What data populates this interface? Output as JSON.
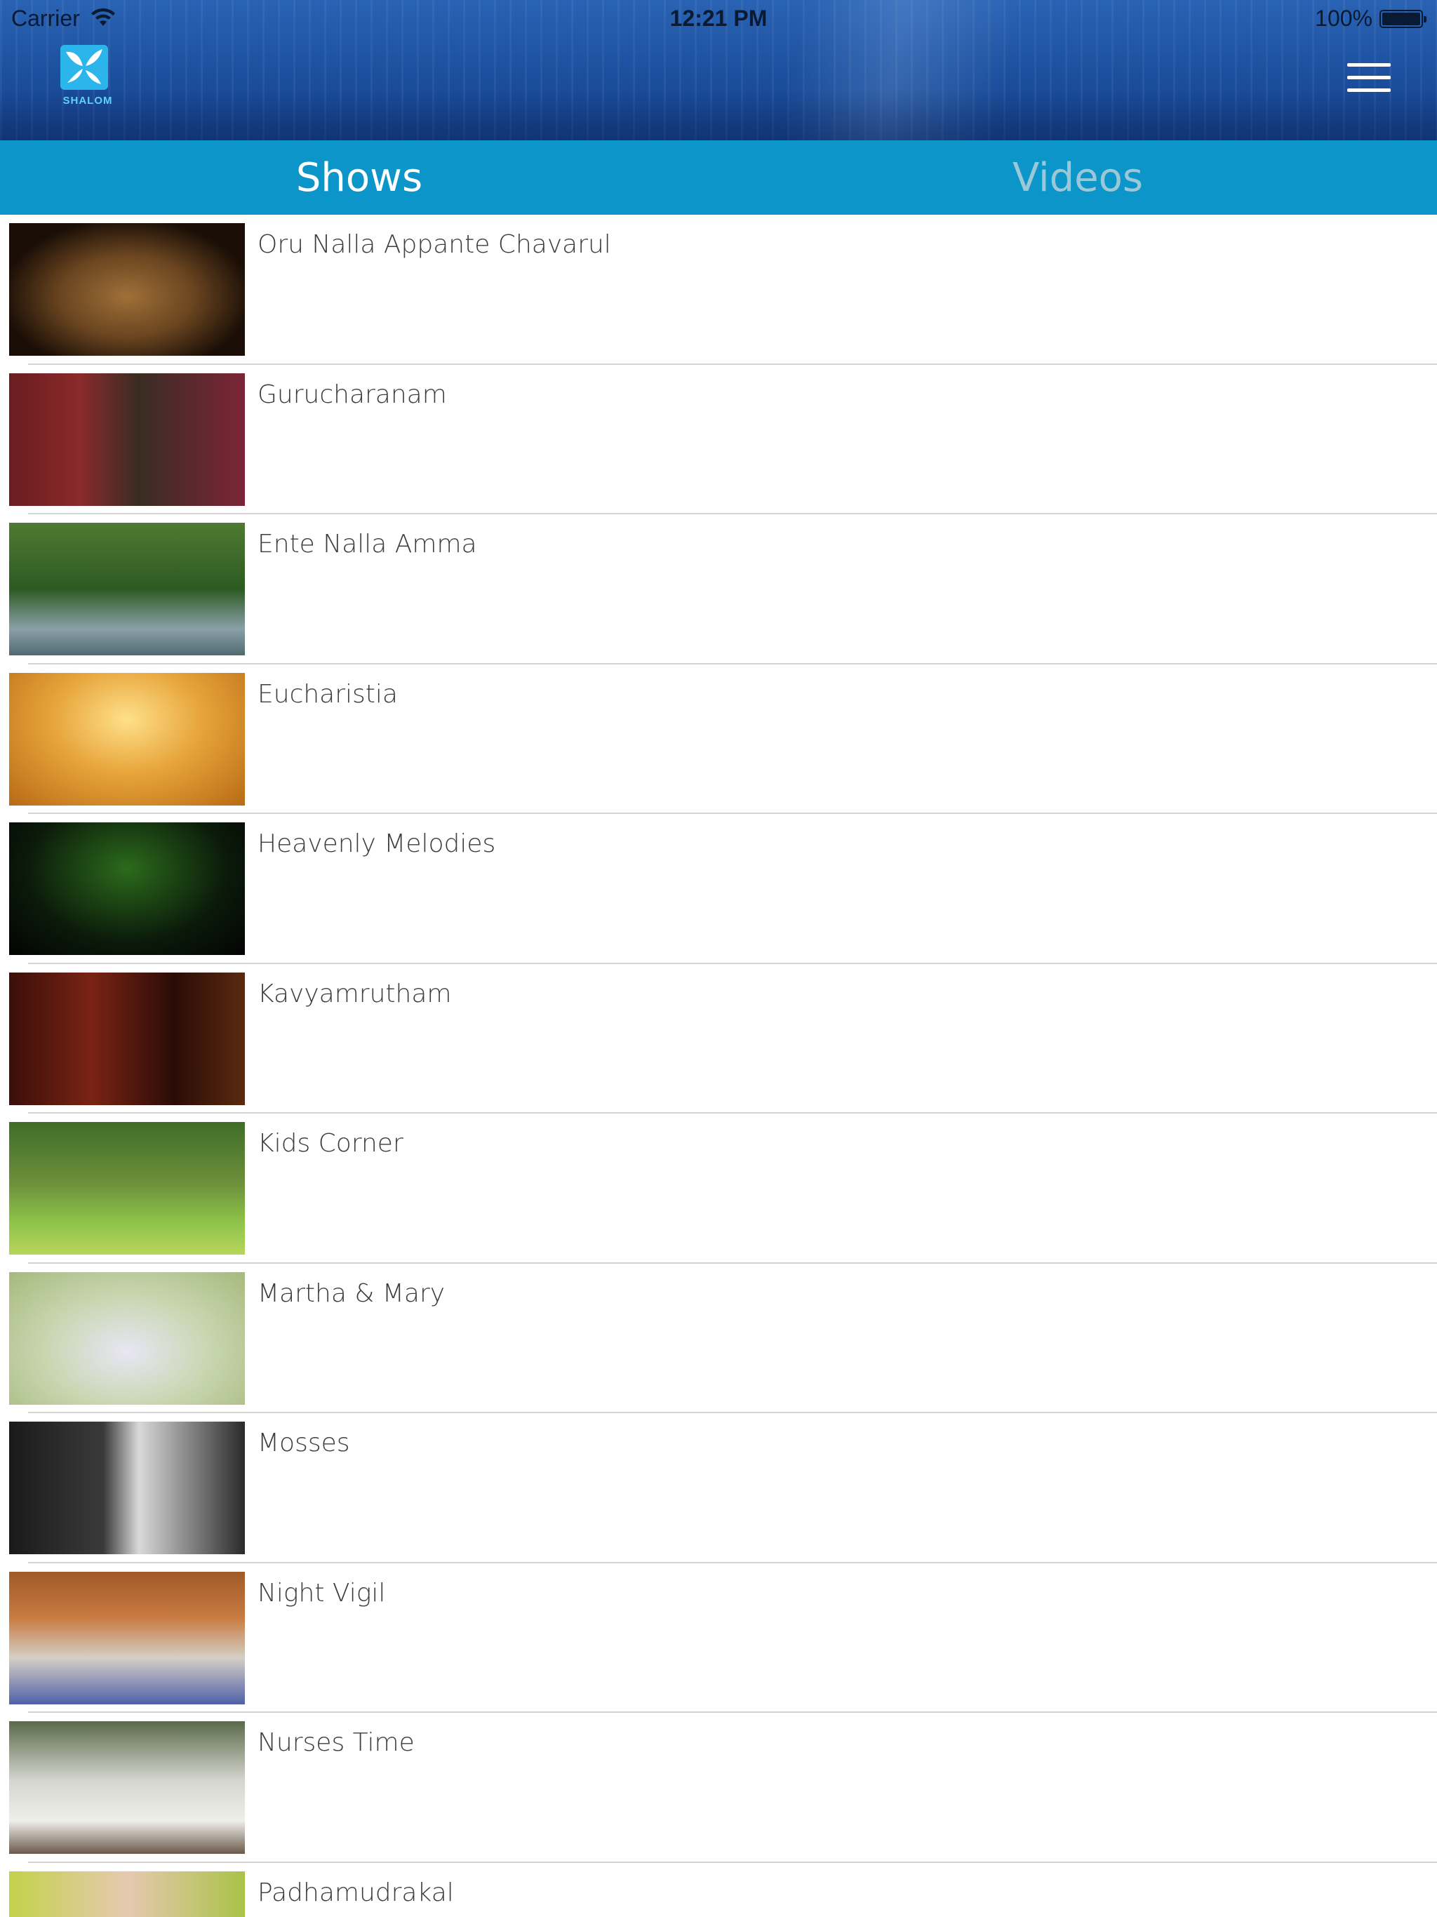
{
  "status_bar": {
    "carrier": "Carrier",
    "time": "12:21 PM",
    "battery": "100%"
  },
  "header": {
    "logo_text": "SHALOM",
    "menu_icon": "hamburger-menu-icon"
  },
  "tabs": [
    {
      "label": "Shows",
      "selected": true
    },
    {
      "label": "Videos",
      "selected": false
    }
  ],
  "shows": [
    {
      "title": "Oru Nalla Appante Chavarul"
    },
    {
      "title": "Gurucharanam"
    },
    {
      "title": "Ente Nalla Amma"
    },
    {
      "title": "Eucharistia"
    },
    {
      "title": "Heavenly Melodies"
    },
    {
      "title": "Kavyamrutham"
    },
    {
      "title": "Kids Corner"
    },
    {
      "title": "Martha & Mary"
    },
    {
      "title": "Mosses"
    },
    {
      "title": "Night Vigil"
    },
    {
      "title": "Nurses Time"
    },
    {
      "title": "Padhamudrakal"
    }
  ],
  "colors": {
    "header_blue": "#1b4f9e",
    "tab_bar": "#0c95c8",
    "tab_selected_text": "#ffffff",
    "tab_unselected_text": "#9cc7d6",
    "row_title_text": "#3d3d3d",
    "separator": "#d4d4d4"
  }
}
